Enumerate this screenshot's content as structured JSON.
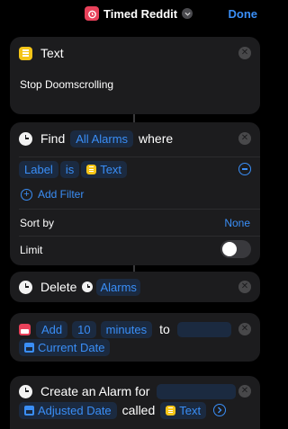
{
  "nav": {
    "title": "Timed Reddit",
    "done": "Done"
  },
  "text_action": {
    "title": "Text",
    "content": "Stop Doomscrolling"
  },
  "find_action": {
    "verb": "Find",
    "subject": "All Alarms",
    "where": "where",
    "filter_field": "Label",
    "filter_op": "is",
    "filter_value": "Text",
    "add_filter": "Add Filter",
    "sort_label": "Sort by",
    "sort_value": "None",
    "limit_label": "Limit",
    "limit_on": false
  },
  "delete_action": {
    "verb": "Delete",
    "target": "Alarms"
  },
  "add_action": {
    "verb": "Add",
    "amount": "10",
    "unit": "minutes",
    "to": "to",
    "base": "Current Date"
  },
  "create_action": {
    "title": "Create an Alarm for",
    "date": "Adjusted Date",
    "called": "called",
    "label": "Text"
  },
  "colors": {
    "accent": "#3a8ef6",
    "card": "#1c1c1e",
    "yellow": "#f5c518",
    "red": "#e8415a"
  }
}
